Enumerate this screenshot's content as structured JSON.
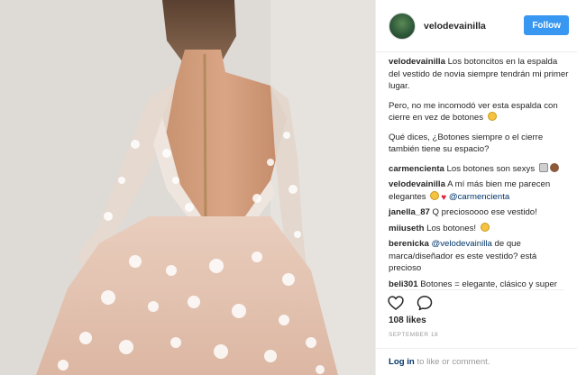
{
  "post": {
    "username": "velodevainilla",
    "follow_label": "Follow",
    "caption_user": "velodevainilla",
    "caption_line1": "Los botoncitos en la espalda del vestido de novia siempre tendrán mi primer lugar.",
    "caption_line2": "Pero, no me incomodó ver esta espalda con cierre en vez de botones",
    "caption_line3": "Qué dices, ¿Botones siempre o el cierre también tiene su espacio?"
  },
  "comments": [
    {
      "user": "carmencienta",
      "text": "Los botones son sexys"
    },
    {
      "user": "velodevainilla",
      "text": "A mí más bien me parecen elegantes",
      "mention": "@carmencienta"
    },
    {
      "user": "janella_87",
      "text": "Q preciosoooo ese vestido!"
    },
    {
      "user": "miiuseth",
      "text": "Los botones!"
    },
    {
      "user": "berenicka",
      "mention": "@velodevainilla",
      "text": "de que marca/diseñador es este vestido? está precioso"
    },
    {
      "user": "beli301",
      "text": "Botones = elegante, clásico y super"
    }
  ],
  "actions": {
    "like_icon": "heart-outline-icon",
    "comment_icon": "speech-bubble-icon"
  },
  "likes": "108 likes",
  "date": "SEPTEMBER 18",
  "footer": {
    "login": "Log in",
    "rest": "to like or comment."
  },
  "colors": {
    "follow_button": "#3897f0",
    "link": "#003569",
    "muted": "#999999"
  }
}
